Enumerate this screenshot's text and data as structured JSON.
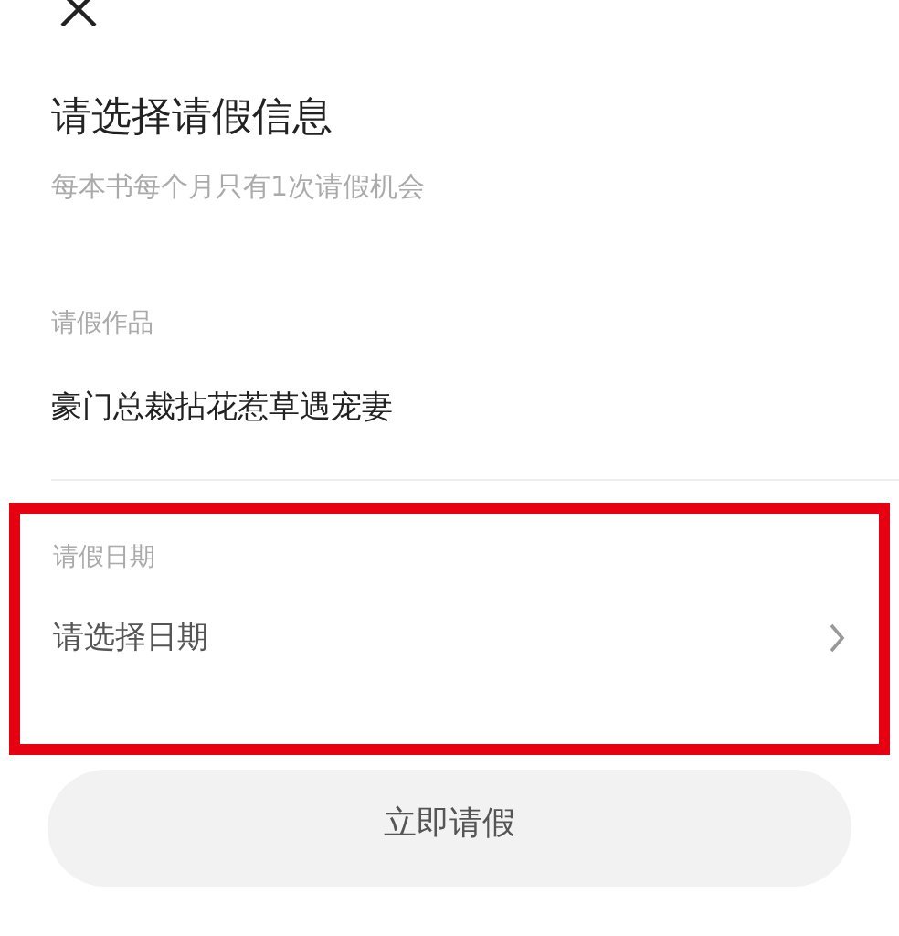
{
  "title": "请选择请假信息",
  "subtitle": "每本书每个月只有1次请假机会",
  "fields": [
    {
      "label": "请假作品",
      "value": "豪门总裁拈花惹草遇宠妻",
      "kind": "text",
      "highlighted": false
    },
    {
      "label": "请假日期",
      "value": "请选择日期",
      "kind": "picker",
      "highlighted": true
    }
  ],
  "submit_button": "立即请假"
}
